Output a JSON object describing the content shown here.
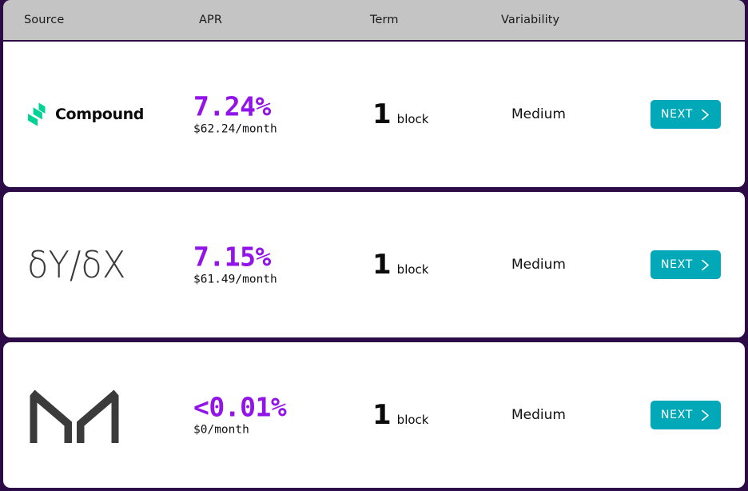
{
  "colors": {
    "page_background": "#2d0b47",
    "header_background": "#c4c4c4",
    "row_background": "#ffffff",
    "apr_accent": "#9214e8",
    "button_accent": "#00a8b8",
    "compound_logo_green": "#00d395",
    "maker_logo_gray": "#3b3b3b"
  },
  "header": {
    "columns": [
      {
        "key": "source",
        "label": "Source"
      },
      {
        "key": "apr",
        "label": "APR"
      },
      {
        "key": "term",
        "label": "Term"
      },
      {
        "key": "variability",
        "label": "Variability"
      },
      {
        "key": "action",
        "label": ""
      }
    ]
  },
  "rows": [
    {
      "source_name": "Compound",
      "logo_icon": "compound-logo-icon",
      "apr": "7.24%",
      "cost": "$62.24/month",
      "term_value": "1",
      "term_unit": "block",
      "variability": "Medium",
      "action_label": "NEXT"
    },
    {
      "source_name": "δY/δX",
      "logo_icon": "dydx-logo-icon",
      "apr": "7.15%",
      "cost": "$61.49/month",
      "term_value": "1",
      "term_unit": "block",
      "variability": "Medium",
      "action_label": "NEXT"
    },
    {
      "source_name": "Maker",
      "logo_icon": "maker-logo-icon",
      "apr": "<0.01%",
      "cost": "$0/month",
      "term_value": "1",
      "term_unit": "block",
      "variability": "Medium",
      "action_label": "NEXT"
    }
  ]
}
